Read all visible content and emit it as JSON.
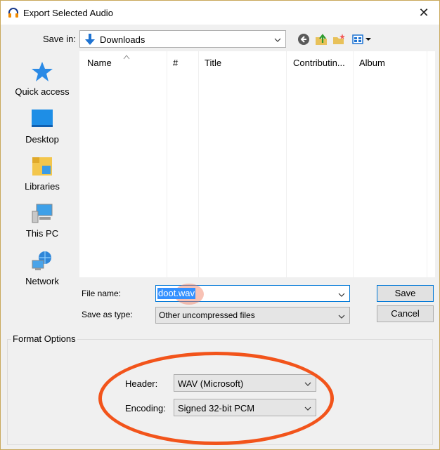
{
  "window": {
    "title": "Export Selected Audio",
    "close_glyph": "✕"
  },
  "toolbar": {
    "save_in_label": "Save in:",
    "save_in_value": "Downloads",
    "icons": [
      "back-icon",
      "up-folder-icon",
      "new-folder-icon",
      "view-menu-icon"
    ]
  },
  "places": [
    {
      "label": "Quick access",
      "icon": "star-icon"
    },
    {
      "label": "Desktop",
      "icon": "desktop-icon"
    },
    {
      "label": "Libraries",
      "icon": "libraries-icon"
    },
    {
      "label": "This PC",
      "icon": "computer-icon"
    },
    {
      "label": "Network",
      "icon": "network-icon"
    }
  ],
  "file_list": {
    "columns": [
      "Name",
      "#",
      "Title",
      "Contributin...",
      "Album"
    ]
  },
  "fields": {
    "file_name_label": "File name:",
    "file_name_value": "doot.wav",
    "save_type_label": "Save as type:",
    "save_type_value": "Other uncompressed files"
  },
  "buttons": {
    "save": "Save",
    "cancel": "Cancel"
  },
  "format_options": {
    "title": "Format Options",
    "header_label": "Header:",
    "header_value": "WAV (Microsoft)",
    "encoding_label": "Encoding:",
    "encoding_value": "Signed 32-bit PCM"
  },
  "colors": {
    "accent": "#0078d7",
    "annotation": "#f2541b"
  }
}
